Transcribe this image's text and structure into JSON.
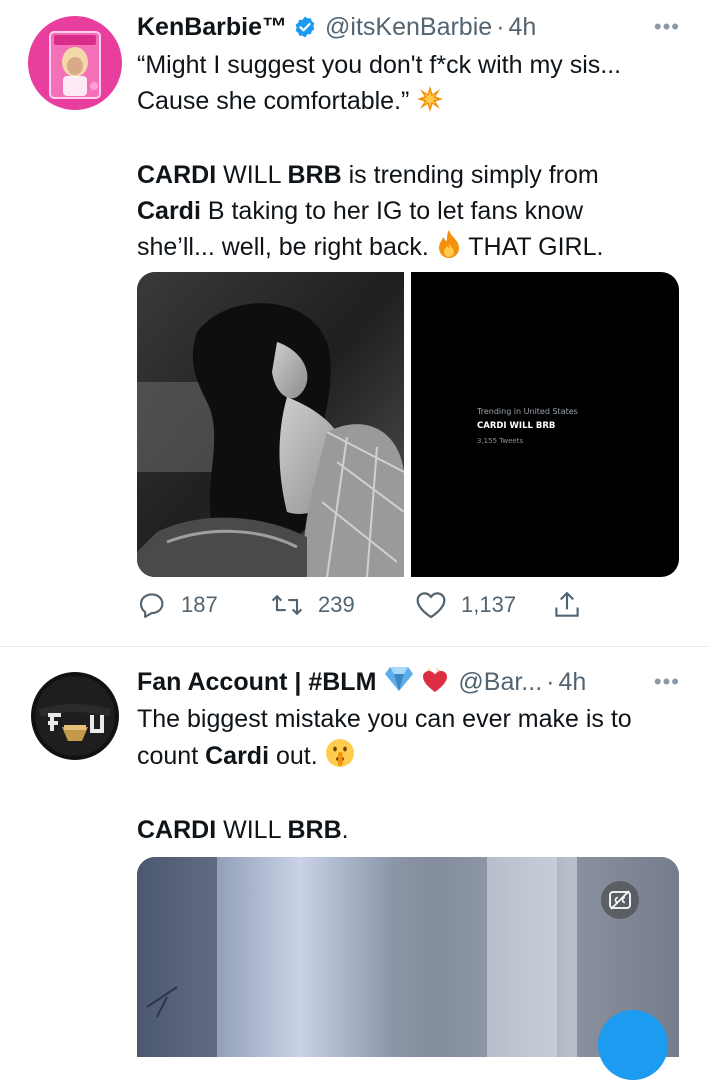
{
  "tweets": [
    {
      "name": "KenBarbie™",
      "handle": "@itsKenBarbie",
      "sep": "·",
      "time": "4h",
      "more": "•••",
      "line1": "“Might I suggest you don't f*ck with my sis...",
      "line2": "Cause she comfortable.”",
      "body": {
        "w_cardi": "CARDI",
        "t_will": " WILL ",
        "w_brb": "BRB",
        "t_rest1": " is trending simply from",
        "w_cardi2": "Cardi",
        "t_rest2": " B taking to her IG to let fans know",
        "t_rest3": "she’ll... well, be right back. ",
        "t_rest4": " THAT GIRL."
      },
      "trend": {
        "title": "Trending in United States",
        "topic": "CARDI WILL BRB",
        "count": "3,155 Tweets"
      },
      "actions": {
        "replies": "187",
        "retweets": "239",
        "likes": "1,137"
      }
    },
    {
      "name": "Fan Account | #BLM",
      "handle": "@Bar...",
      "sep": "·",
      "time": "4h",
      "more": "•••",
      "line1": "The biggest mistake you can ever make is to",
      "t_count": "count ",
      "w_cardi": "Cardi",
      "t_out": " out.",
      "w_cardi2": "CARDI",
      "t_will": " WILL ",
      "w_brb": "BRB",
      "t_end": "."
    }
  ],
  "colors": {
    "accent": "#1d9bf0",
    "secondary_text": "#536471",
    "divider": "#e6ecf0"
  }
}
